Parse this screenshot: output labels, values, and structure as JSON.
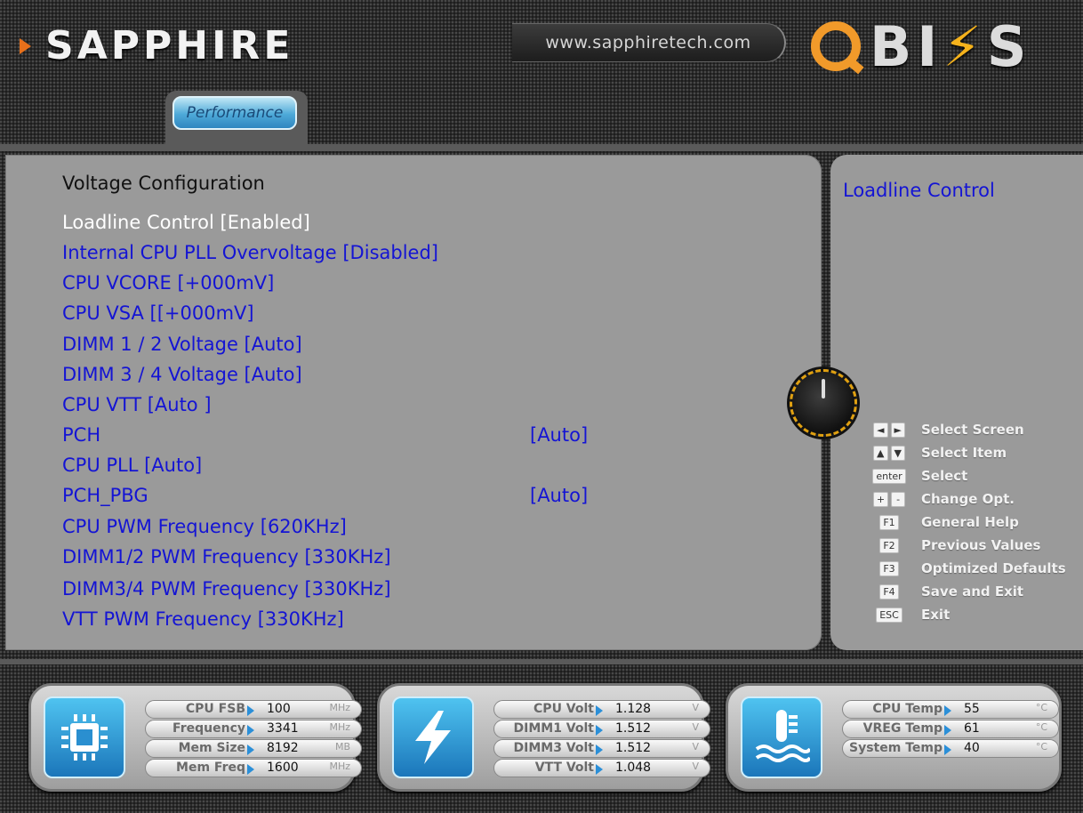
{
  "header": {
    "brand": "SAPPHIRE",
    "url": "www.sapphiretech.com",
    "logo_q": "Q",
    "logo_bios": "BI",
    "logo_bolt": "⚡",
    "logo_s": "S",
    "tab": "Performance"
  },
  "main": {
    "section_title": "Voltage Configuration",
    "settings": [
      {
        "label": "Loadline Control  [Enabled]",
        "value": ""
      },
      {
        "label": "Internal CPU PLL Overvoltage  [Disabled]",
        "value": ""
      },
      {
        "label": "CPU VCORE  [+000mV]",
        "value": ""
      },
      {
        "label": "CPU VSA  [[+000mV]",
        "value": ""
      },
      {
        "label": "DIMM 1 / 2 Voltage  [Auto]",
        "value": ""
      },
      {
        "label": "DIMM 3 / 4 Voltage  [Auto]",
        "value": ""
      },
      {
        "label": "CPU VTT  [Auto ]",
        "value": ""
      },
      {
        "label": "PCH",
        "value": "[Auto]"
      },
      {
        "label": "CPU PLL  [Auto]",
        "value": ""
      },
      {
        "label": "PCH_PBG",
        "value": "[Auto]"
      },
      {
        "label": "CPU PWM Frequency  [620KHz]",
        "value": ""
      },
      {
        "label": "DIMM1/2 PWM Frequency  [330KHz]",
        "value": ""
      },
      {
        "label": "DIMM3/4 PWM Frequency  [330KHz]",
        "value": ""
      },
      {
        "label": "VTT PWM Frequency  [330KHz]",
        "value": ""
      }
    ],
    "selected_index": 0
  },
  "help": {
    "title": "Loadline Control",
    "keys": [
      {
        "caps": [
          "◄",
          "►"
        ],
        "label": "Select Screen"
      },
      {
        "caps": [
          "▲",
          "▼"
        ],
        "label": "Select Item"
      },
      {
        "caps": [
          "enter"
        ],
        "label": "Select"
      },
      {
        "caps": [
          "+",
          "-"
        ],
        "label": "Change Opt."
      },
      {
        "caps": [
          "F1"
        ],
        "label": "General Help"
      },
      {
        "caps": [
          "F2"
        ],
        "label": "Previous Values"
      },
      {
        "caps": [
          "F3"
        ],
        "label": "Optimized Defaults"
      },
      {
        "caps": [
          "F4"
        ],
        "label": "Save and Exit"
      },
      {
        "caps": [
          "ESC"
        ],
        "label": "Exit"
      }
    ]
  },
  "status": {
    "cpu": {
      "icon": "chip-icon",
      "rows": [
        {
          "label": "CPU FSB",
          "value": "100",
          "unit": "MHz"
        },
        {
          "label": "Frequency",
          "value": "3341",
          "unit": "MHz"
        },
        {
          "label": "Mem Size",
          "value": "8192",
          "unit": "MB"
        },
        {
          "label": "Mem Freq",
          "value": "1600",
          "unit": "MHz"
        }
      ]
    },
    "volt": {
      "icon": "lightning-icon",
      "rows": [
        {
          "label": "CPU Volt",
          "value": "1.128",
          "unit": "V"
        },
        {
          "label": "DIMM1 Volt",
          "value": "1.512",
          "unit": "V"
        },
        {
          "label": "DIMM3 Volt",
          "value": "1.512",
          "unit": "V"
        },
        {
          "label": "VTT Volt",
          "value": "1.048",
          "unit": "V"
        }
      ]
    },
    "temp": {
      "icon": "thermometer-icon",
      "rows": [
        {
          "label": "CPU Temp",
          "value": "55",
          "unit": "°C"
        },
        {
          "label": "VREG Temp",
          "value": "61",
          "unit": "°C"
        },
        {
          "label": "System Temp",
          "value": "40",
          "unit": "°C"
        }
      ]
    }
  }
}
